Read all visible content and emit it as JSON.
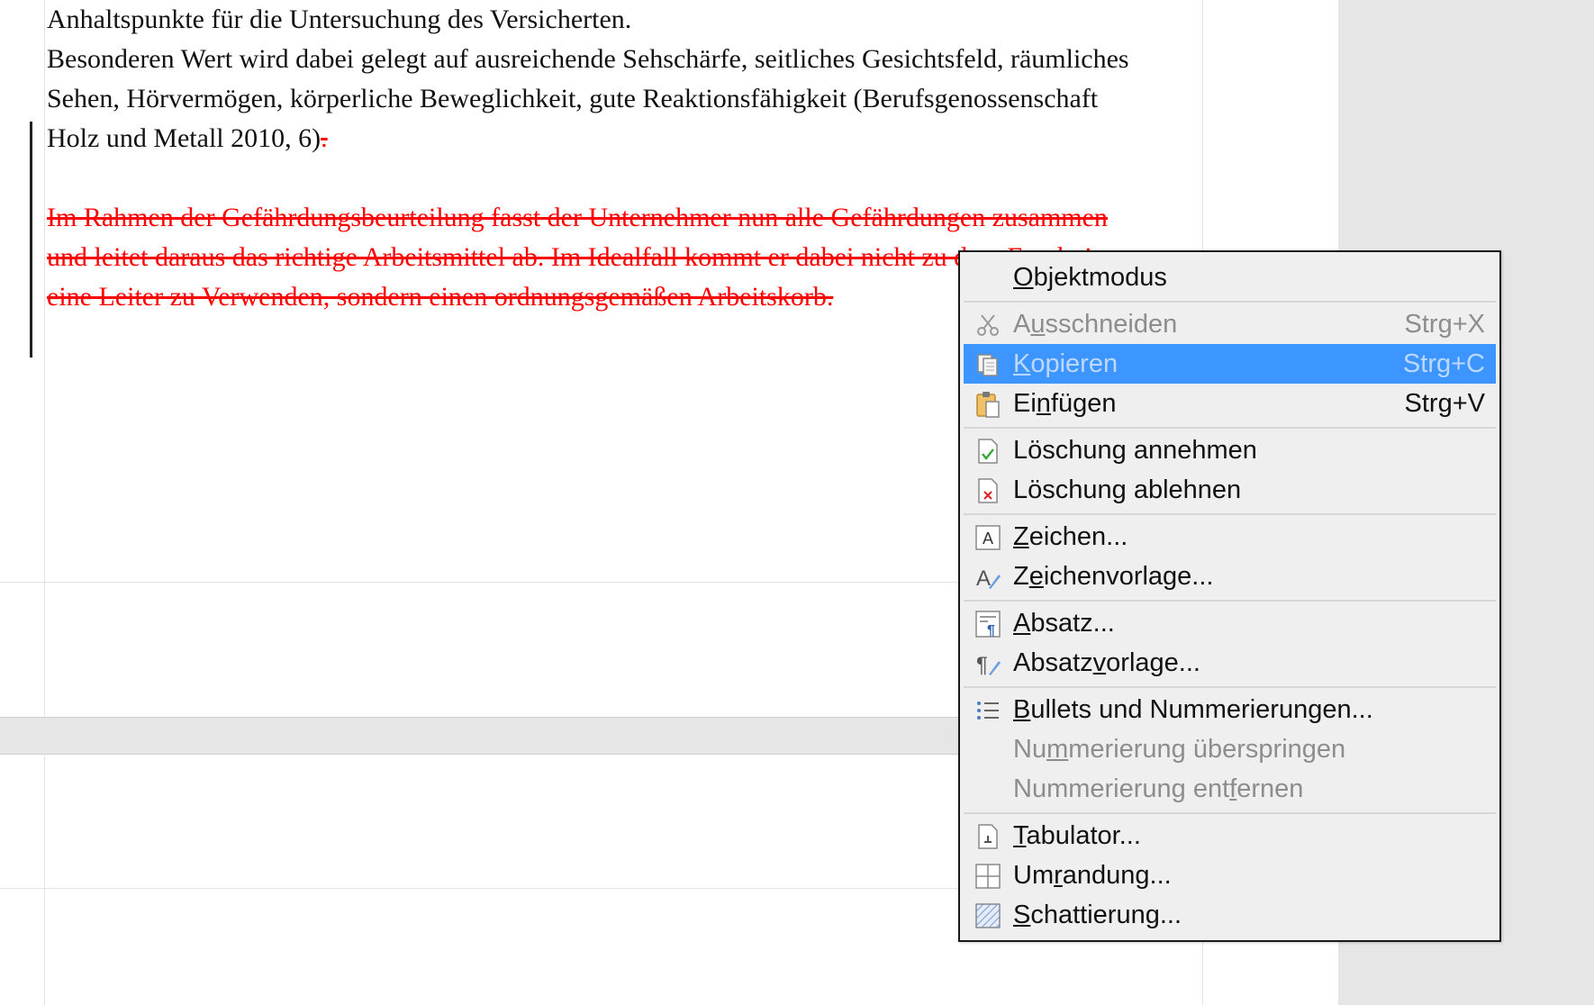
{
  "document": {
    "lines_normal": [
      "Anhaltspunkte für die Untersuchung des Versicherten.",
      "Besonderen Wert wird dabei gelegt auf ausreichende Sehschärfe, seitliches Gesichtsfeld, räumliches",
      "Sehen, Hörvermögen, körperliche Beweglichkeit, gute Reaktionsfähigkeit (Berufsgenossenschaft",
      "Holz und Metall 2010, 6)"
    ],
    "deleted_period": ".",
    "lines_deleted": [
      "Im Rahmen der Gefährdungsbeurteilung fasst der Unternehmer nun alle Gefährdungen zusammen",
      "und leitet daraus das richtige Arbeitsmittel ab. Im Idealfall kommt er dabei nicht zu dem Ergebnis",
      "eine Leiter zu Verwenden, sondern einen ordnungsgemäßen Arbeitskorb."
    ],
    "deleted_color": "#ff0000"
  },
  "context_menu": {
    "highlight_color": "#3d95ff",
    "items": [
      {
        "label_pre": "",
        "mnemonic": "O",
        "label_post": "bjektmodus",
        "shortcut": "",
        "icon": "none",
        "disabled": false
      },
      {
        "label_pre": "A",
        "mnemonic": "u",
        "label_post": "sschneiden",
        "shortcut": "Strg+X",
        "icon": "scissors-icon",
        "disabled": true
      },
      {
        "label_pre": "",
        "mnemonic": "K",
        "label_post": "opieren",
        "shortcut": "Strg+C",
        "icon": "copy-icon",
        "disabled": true,
        "highlighted": true
      },
      {
        "label_pre": "Ei",
        "mnemonic": "n",
        "label_post": "fügen",
        "shortcut": "Strg+V",
        "icon": "paste-icon",
        "disabled": false
      },
      {
        "label_pre": "Löschung annehmen",
        "mnemonic": "",
        "label_post": "",
        "shortcut": "",
        "icon": "accept-change-icon",
        "disabled": false
      },
      {
        "label_pre": "Löschung ablehnen",
        "mnemonic": "",
        "label_post": "",
        "shortcut": "",
        "icon": "reject-change-icon",
        "disabled": false
      },
      {
        "label_pre": "",
        "mnemonic": "Z",
        "label_post": "eichen...",
        "shortcut": "",
        "icon": "character-icon",
        "disabled": false
      },
      {
        "label_pre": "Z",
        "mnemonic": "e",
        "label_post": "ichenvorlage...",
        "shortcut": "",
        "icon": "character-style-icon",
        "disabled": false
      },
      {
        "label_pre": "",
        "mnemonic": "A",
        "label_post": "bsatz...",
        "shortcut": "",
        "icon": "paragraph-icon",
        "disabled": false
      },
      {
        "label_pre": "Absatz",
        "mnemonic": "v",
        "label_post": "orlage...",
        "shortcut": "",
        "icon": "paragraph-style-icon",
        "disabled": false
      },
      {
        "label_pre": "",
        "mnemonic": "B",
        "label_post": "ullets und Nummerierungen...",
        "shortcut": "",
        "icon": "bullets-icon",
        "disabled": false
      },
      {
        "label_pre": "Nu",
        "mnemonic": "m",
        "label_post": "merierung überspringen",
        "shortcut": "",
        "icon": "none",
        "disabled": true
      },
      {
        "label_pre": "Nummerierung ent",
        "mnemonic": "f",
        "label_post": "ernen",
        "shortcut": "",
        "icon": "none",
        "disabled": true
      },
      {
        "label_pre": "",
        "mnemonic": "T",
        "label_post": "abulator...",
        "shortcut": "",
        "icon": "tabulator-icon",
        "disabled": false
      },
      {
        "label_pre": "Um",
        "mnemonic": "r",
        "label_post": "andung...",
        "shortcut": "",
        "icon": "border-icon",
        "disabled": false
      },
      {
        "label_pre": "",
        "mnemonic": "S",
        "label_post": "chattierung...",
        "shortcut": "",
        "icon": "shading-icon",
        "disabled": false
      }
    ]
  }
}
